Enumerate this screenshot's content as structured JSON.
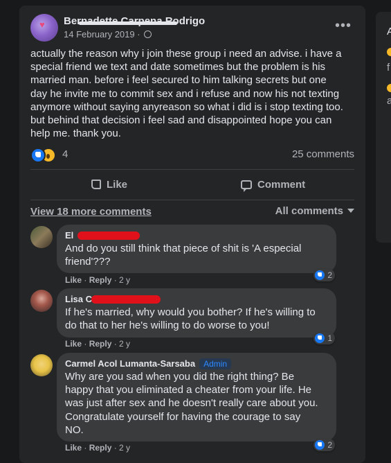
{
  "post": {
    "author": "Bernadette Carpena Rodrigo",
    "date": "14 February 2019",
    "more_label": "•••",
    "text": "actually the reason why i join these group i need an advise. i have a\nspecial friend we text and date sometimes but the problem is his\nmarried man. before i feel secured to him talking secrets but one\nday he invite me to commit sex and i refuse and now his not texting\nanymore without saying anyreason so what i did is i stop texting too.\nbut behind that decision i feel sad and disappointed hope you can\nhelp me. thank you.",
    "reaction_count": "4",
    "comment_count": "25 comments",
    "like_label": "Like",
    "comment_label": "Comment"
  },
  "comments_header": {
    "view_more": "View 18 more comments",
    "filter": "All comments"
  },
  "comments": [
    {
      "name": "El",
      "text": "And do you still think that piece of shit is 'A especial\nfriend'???",
      "like": "Like",
      "reply": "Reply",
      "time": "2 y",
      "reactions": "2"
    },
    {
      "name": "Lisa C",
      "text": "If he's married, why would you bother? If he's willing to\ndo that to her he's willing to do worse to you!",
      "like": "Like",
      "reply": "Reply",
      "time": "2 y",
      "reactions": "1"
    },
    {
      "name": "Carmel Acol Lumanta-Sarsaba",
      "badge": "Admin",
      "text": "Why are you sad when you did the right thing? Be\nhappy that you eliminated a cheater from your life. He\nwas just after sex and he doesn't really care about you.\nCongratulate yourself for having the courage to say\nNO.",
      "like": "Like",
      "reply": "Reply",
      "time": "2 y",
      "reactions": "2"
    }
  ],
  "sidebar_fragments": [
    "A",
    "f",
    "a"
  ],
  "colors": {
    "background": "#18191a",
    "card": "#242526",
    "bubble": "#3a3b3c",
    "text": "#e4e6eb",
    "secondary": "#b0b3b8",
    "like_blue": "#1877f2",
    "redaction": "#e0111b"
  }
}
